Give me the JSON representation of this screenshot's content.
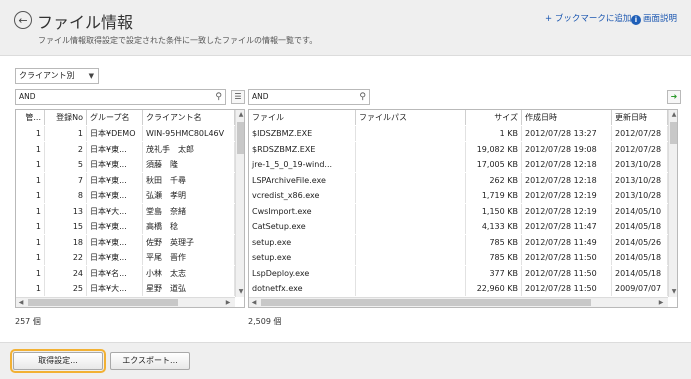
{
  "header": {
    "title": "ファイル情報",
    "description": "ファイル情報取得設定で設定された条件に一致したファイルの情報一覧です。",
    "bookmark_link": "+ ブックマークに追加",
    "help_icon": "i",
    "help_link": "画面説明"
  },
  "filter": {
    "selected": "クライアント別"
  },
  "left_panel": {
    "search_value": "AND",
    "columns": [
      "管...",
      "登録No",
      "グループ名",
      "クライアント名"
    ],
    "rows": [
      [
        "1",
        "1",
        "日本¥DEMO",
        "WIN-95HMC80L46V"
      ],
      [
        "1",
        "2",
        "日本¥東...",
        "茂礼手　太郎"
      ],
      [
        "1",
        "5",
        "日本¥東...",
        "須藤　隆"
      ],
      [
        "1",
        "7",
        "日本¥東...",
        "秋田　千尋"
      ],
      [
        "1",
        "8",
        "日本¥東...",
        "弘瀬　孝明"
      ],
      [
        "1",
        "13",
        "日本¥大...",
        "堂島　奈緒"
      ],
      [
        "1",
        "15",
        "日本¥東...",
        "高橋　稔"
      ],
      [
        "1",
        "18",
        "日本¥東...",
        "佐野　英理子"
      ],
      [
        "1",
        "22",
        "日本¥東...",
        "平尾　晋作"
      ],
      [
        "1",
        "24",
        "日本¥名...",
        "小林　太志"
      ],
      [
        "1",
        "25",
        "日本¥大...",
        "星野　道弘"
      ]
    ],
    "count": "257 個"
  },
  "right_panel": {
    "search_value": "AND",
    "columns": [
      "ファイル",
      "ファイルパス",
      "サイズ",
      "作成日時",
      "更新日時"
    ],
    "rows": [
      [
        "$IDSZBMZ.EXE",
        "",
        "1 KB",
        "2012/07/28 13:27",
        "2012/07/28"
      ],
      [
        "$RDSZBMZ.EXE",
        "",
        "19,082 KB",
        "2012/07/28 19:08",
        "2012/07/28"
      ],
      [
        "jre-1_5_0_19-wind...",
        "",
        "17,005 KB",
        "2012/07/28 12:18",
        "2013/10/28"
      ],
      [
        "LSPArchiveFile.exe",
        "",
        "262 KB",
        "2012/07/28 12:18",
        "2013/10/28"
      ],
      [
        "vcredist_x86.exe",
        "",
        "1,719 KB",
        "2012/07/28 12:19",
        "2013/10/28"
      ],
      [
        "CwsImport.exe",
        "",
        "1,150 KB",
        "2012/07/28 12:19",
        "2014/05/10"
      ],
      [
        "CatSetup.exe",
        "",
        "4,133 KB",
        "2012/07/28 11:47",
        "2014/05/18"
      ],
      [
        "setup.exe",
        "",
        "785 KB",
        "2012/07/28 11:49",
        "2014/05/26"
      ],
      [
        "setup.exe",
        "",
        "785 KB",
        "2012/07/28 11:50",
        "2014/05/18"
      ],
      [
        "LspDeploy.exe",
        "",
        "377 KB",
        "2012/07/28 11:50",
        "2014/05/18"
      ],
      [
        "dotnetfx.exe",
        "",
        "22,960 KB",
        "2012/07/28 11:50",
        "2009/07/07"
      ]
    ],
    "count": "2,509 個"
  },
  "footer": {
    "acquire_button": "取得設定...",
    "export_button": "エクスポート..."
  },
  "icons": {
    "back": "back-arrow-icon",
    "search": "search-icon",
    "list": "list-icon",
    "export": "export-icon",
    "help": "help-icon"
  },
  "colors": {
    "accent_link": "#1a56b0",
    "focus_outline": "#f2b134",
    "export_icon": "#2c9a2c"
  }
}
